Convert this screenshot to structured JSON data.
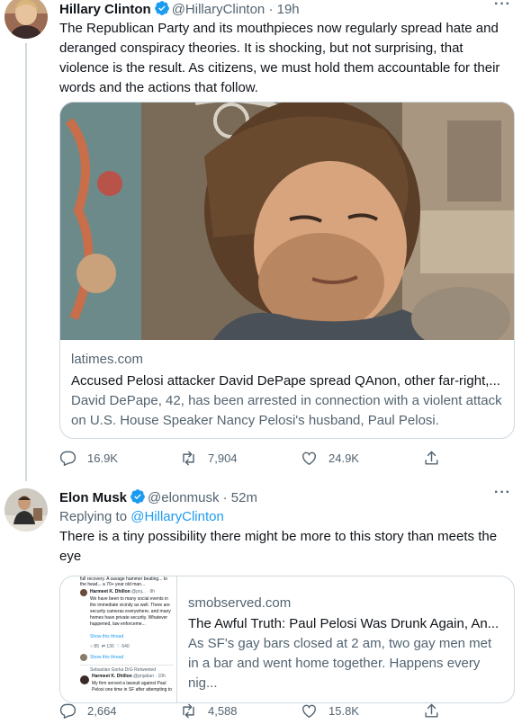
{
  "tweet1": {
    "name": "Hillary Clinton",
    "handle": "@HillaryClinton",
    "time": "· 19h",
    "text": "The Republican Party and its mouthpieces now regularly spread hate and deranged conspiracy theories. It is shocking, but not surprising, that violence is the result. As citizens, we must hold them accountable for their words and the actions that follow.",
    "card": {
      "domain": "latimes.com",
      "title": "Accused Pelosi attacker David DePape spread QAnon, other far-right,...",
      "description": "David DePape, 42, has been arrested in connection with a violent attack on U.S. House Speaker Nancy Pelosi's husband, Paul Pelosi."
    },
    "replies": "16.9K",
    "retweets": "7,904",
    "likes": "24.9K"
  },
  "tweet2": {
    "name": "Elon Musk",
    "handle": "@elonmusk",
    "time": "· 52m",
    "replying_label": "Replying to",
    "replying_handle": "@HillaryClinton",
    "text": "There is a tiny possibility there might be more to this story than meets the eye",
    "card": {
      "domain": "smobserved.com",
      "title": "The Awful Truth: Paul Pelosi Was Drunk Again, An...",
      "description": "As SF's gay bars closed at 2 am, two gay men met in a bar and went home together. Happens every nig..."
    },
    "thumb": {
      "top_text": "full recovery. A savage hammer beating... to the head... a 70+ year old man...",
      "author": "Harmeet K. Dhillon",
      "author_handle": "@pnj... · 9h",
      "body": "We have been to many social events in the immediate vicinity as well. There are security cameras everywhere, and many homes have private security. Whatever happened, law enforceme...",
      "show_thread": "Show this thread",
      "stat_reply": "85",
      "stat_rt": "130",
      "stat_like": "640",
      "show_thread2": "Show this thread",
      "retweeted": "Sebastian Gorka DrG Retweeted",
      "author2_handle": "@pnjaban · 10h",
      "body2": "My firm served a lawsuit against Paul Pelosi one time in SF after attempting to"
    },
    "replies": "2,664",
    "retweets": "4,588",
    "likes": "15.8K"
  },
  "more_label": "···"
}
